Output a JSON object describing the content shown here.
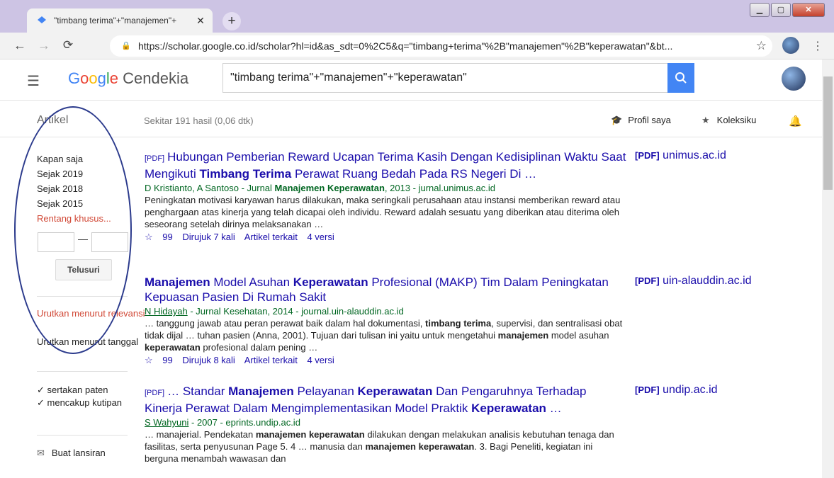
{
  "browser": {
    "tab_title": "\"timbang terima\"+\"manajemen\"+",
    "url": "https://scholar.google.co.id/scholar?hl=id&as_sdt=0%2C5&q=\"timbang+terima\"%2B\"manajemen\"%2B\"keperawatan\"&bt...",
    "colors": {
      "titlebar": "#cdc4e4"
    }
  },
  "header": {
    "logo_google": "Google",
    "logo_product": "Cendekia",
    "search_value": "\"timbang terima\"+\"manajemen\"+\"keperawatan\""
  },
  "subbar": {
    "section": "Artikel",
    "result_count": "Sekitar 191 hasil (0,06 dtk)",
    "profile": "Profil saya",
    "library": "Koleksiku"
  },
  "sidebar": {
    "time_filters": [
      "Kapan saja",
      "Sejak 2019",
      "Sejak 2018",
      "Sejak 2015"
    ],
    "custom_range": "Rentang khusus...",
    "search_button": "Telusuri",
    "sort_relevance": "Urutkan menurut relevansi",
    "sort_date": "Urutkan menurut tanggal",
    "include_patents": "sertakan paten",
    "include_citations": "mencakup kutipan",
    "create_alert": "Buat lansiran"
  },
  "results": [
    {
      "title_a": "Hubungan Pemberian Reward Ucapan Terima Kasih Dengan Kedisiplinan Waktu Saat Mengikuti ",
      "title_b": "Timbang Terima",
      "title_c": " Perawat Ruang Bedah Pada RS Negeri Di …",
      "author_a": "D Kristianto, A Santoso - Jurnal ",
      "author_b": "Manajemen Keperawatan",
      "author_c": ", 2013 - jurnal.unimus.ac.id",
      "snippet": "Peningkatan motivasi karyawan harus dilakukan, maka seringkali perusahaan atau instansi memberikan reward atau penghargaan atas kinerja yang telah dicapai oleh individu. Reward adalah sesuatu yang diberikan atau diterima oleh seseorang setelah dirinya melaksanakan …",
      "cited": "Dirujuk 7 kali",
      "related": "Artikel terkait",
      "versions": "4 versi",
      "pdf_source": "unimus.ac.id"
    },
    {
      "title_b1": "Manajemen",
      "title_a": " Model Asuhan ",
      "title_b2": "Keperawatan",
      "title_c": " Profesional (MAKP) Tim Dalam Peningkatan Kepuasan Pasien Di Rumah Sakit",
      "author_link": "N Hidayah",
      "author_rest": " - Jurnal Kesehatan, 2014 - journal.uin-alauddin.ac.id",
      "snippet_1": "… tanggung jawab atau peran perawat baik dalam hal dokumentasi, ",
      "snippet_b1": "timbang terima",
      "snippet_2": ", supervisi, dan sentralisasi obat tidak dijal … tuhan pasien (Anna, 2001). Tujuan dari tulisan ini yaitu untuk mengetahui ",
      "snippet_b2": "manajemen",
      "snippet_3": " model asuhan ",
      "snippet_b3": "keperawatan",
      "snippet_4": " profesional dalam pening …",
      "cited": "Dirujuk 8 kali",
      "related": "Artikel terkait",
      "versions": "4 versi",
      "pdf_source": "uin-alauddin.ac.id"
    },
    {
      "title_a": "… Standar ",
      "title_b1": "Manajemen",
      "title_c": " Pelayanan ",
      "title_b2": "Keperawatan",
      "title_d": " Dan Pengaruhnya Terhadap Kinerja Perawat Dalam Mengimplementasikan Model Praktik ",
      "title_b3": "Keperawatan",
      "title_e": " …",
      "author_link": "S Wahyuni",
      "author_rest": " - 2007 - eprints.undip.ac.id",
      "snippet_1": "… manajerial. Pendekatan ",
      "snippet_b1": "manajemen keperawatan",
      "snippet_2": " dilakukan dengan melakukan analisis kebutuhan tenaga dan fasilitas, serta penyusunan Page 5. 4 … manusia dan ",
      "snippet_b2": "manajemen keperawatan",
      "snippet_3": ". 3. Bagi Peneliti, kegiatan ini berguna menambah wawasan dan",
      "pdf_source": "undip.ac.id"
    }
  ],
  "labels": {
    "pdf_tag": "[PDF]",
    "pdf_tag_right": "[PDF]"
  }
}
